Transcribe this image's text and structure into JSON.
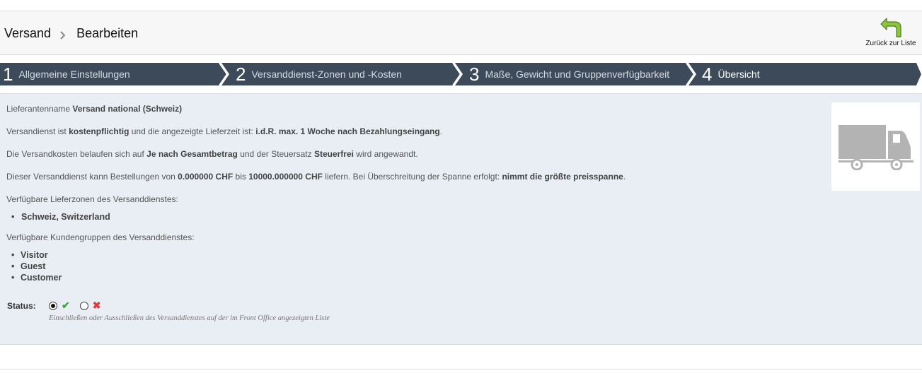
{
  "header": {
    "breadcrumb": [
      "Versand",
      "Bearbeiten"
    ],
    "back_label": "Zurück zur Liste"
  },
  "steps": [
    {
      "num": "1",
      "label": "Allgemeine Einstellungen",
      "active": false
    },
    {
      "num": "2",
      "label": "Versanddienst-Zonen und -Kosten",
      "active": false
    },
    {
      "num": "3",
      "label": "Maße, Gewicht und Gruppenverfügbarkeit",
      "active": false
    },
    {
      "num": "4",
      "label": "Übersicht",
      "active": true
    }
  ],
  "summary": {
    "line1": {
      "t1": "Lieferantenname ",
      "b1": "Versand national (Schweiz)"
    },
    "line2": {
      "t1": "Versandienst ist ",
      "b1": "kostenpflichtig",
      "t2": " und die angezeigte Lieferzeit ist: ",
      "b2": "i.d.R. max. 1 Woche nach Bezahlungseingang",
      "t3": "."
    },
    "line3": {
      "t1": "Die Versandkosten belaufen sich auf ",
      "b1": "Je nach Gesamtbetrag",
      "t2": " und der Steuersatz ",
      "b2": "Steuerfrei",
      "t3": " wird angewandt."
    },
    "line4": {
      "t1": "Dieser Versanddienst kann Bestellungen von ",
      "b1": "0.000000 CHF",
      "t2": " bis ",
      "b2": "10000.000000 CHF",
      "t3": " liefern. Bei Überschreitung der Spanne erfolgt: ",
      "b3": "nimmt die größte preisspanne",
      "t4": "."
    },
    "zones_title": "Verfügbare Lieferzonen des Versanddienstes:",
    "zones": [
      "Schweiz, Switzerland"
    ],
    "groups_title": "Verfügbare Kundengruppen des Versanddienstes:",
    "groups": [
      "Visitor",
      "Guest",
      "Customer"
    ]
  },
  "status": {
    "label": "Status:",
    "enabled": true,
    "hint": "Einschließen oder Ausschließen des Versanddienstes auf der im Front Office angezeigten Liste"
  },
  "colors": {
    "step_bg": "#3d4a5a",
    "panel_bg": "#e9edf4",
    "back_arrow": "#8cc63f",
    "truck": "#b3b3b3"
  },
  "icons": {
    "back": "back-arrow-icon",
    "truck": "truck-icon",
    "ok": "check-icon",
    "no": "cross-icon"
  }
}
